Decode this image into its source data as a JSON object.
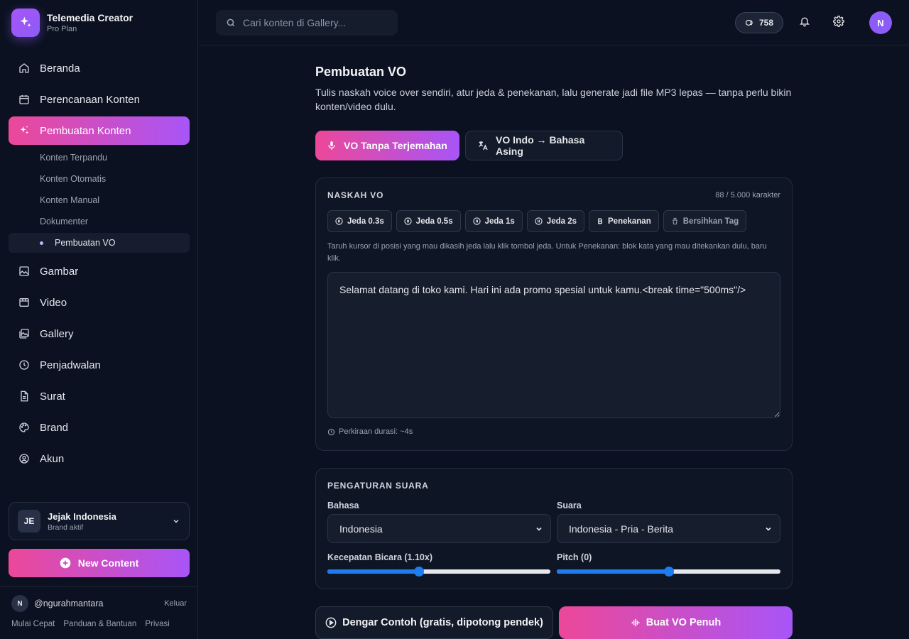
{
  "app": {
    "name": "Telemedia Creator",
    "plan": "Pro Plan"
  },
  "sidebar": {
    "items": [
      {
        "label": "Beranda",
        "icon": "home-icon"
      },
      {
        "label": "Perencanaan Konten",
        "icon": "calendar-icon"
      },
      {
        "label": "Pembuatan Konten",
        "icon": "sparkles-icon",
        "active": true
      },
      {
        "label": "Gambar",
        "icon": "image-icon"
      },
      {
        "label": "Video",
        "icon": "clapperboard-icon"
      },
      {
        "label": "Gallery",
        "icon": "images-icon"
      },
      {
        "label": "Penjadwalan",
        "icon": "clock-icon"
      },
      {
        "label": "Surat",
        "icon": "document-icon"
      },
      {
        "label": "Brand",
        "icon": "palette-icon"
      },
      {
        "label": "Akun",
        "icon": "user-circle-icon"
      }
    ],
    "subitems": [
      {
        "label": "Konten Terpandu"
      },
      {
        "label": "Konten Otomatis"
      },
      {
        "label": "Konten Manual"
      },
      {
        "label": "Dokumenter"
      },
      {
        "label": "Pembuatan VO",
        "active": true
      }
    ],
    "brand_switch": {
      "initials": "JE",
      "name": "Jejak Indonesia",
      "status": "Brand aktif"
    },
    "new_content_label": "New Content",
    "user": {
      "initial": "N",
      "handle": "@ngurahmantara",
      "logout": "Keluar"
    },
    "footer_links": [
      "Mulai Cepat",
      "Panduan & Bantuan",
      "Privasi"
    ]
  },
  "topbar": {
    "search_placeholder": "Cari konten di Gallery...",
    "credits": "758",
    "avatar_initial": "N"
  },
  "page": {
    "title": "Pembuatan VO",
    "description": "Tulis naskah voice over sendiri, atur jeda & penekanan, lalu generate jadi file MP3 lepas — tanpa perlu bikin konten/video dulu.",
    "tabs": [
      {
        "label": "VO Tanpa Terjemahan",
        "active": true
      },
      {
        "label": "VO Indo → Bahasa Asing",
        "active": false
      }
    ]
  },
  "script_card": {
    "title": "NASKAH VO",
    "char_count": "88 / 5.000 karakter",
    "tag_buttons": [
      "Jeda 0.3s",
      "Jeda 0.5s",
      "Jeda 1s",
      "Jeda 2s",
      "Penekanan",
      "Bersihkan Tag"
    ],
    "hint": "Taruh kursor di posisi yang mau dikasih jeda lalu klik tombol jeda. Untuk Penekanan: blok kata yang mau ditekankan dulu, baru klik.",
    "text_value": "Selamat datang di toko kami. Hari ini ada promo spesial untuk kamu.<break time=\"500ms\"/>",
    "duration": "Perkiraan durasi: ~4s"
  },
  "voice_card": {
    "title": "PENGATURAN SUARA",
    "language_label": "Bahasa",
    "language_value": "Indonesia",
    "voice_label": "Suara",
    "voice_value": "Indonesia - Pria - Berita",
    "speed_label": "Kecepatan Bicara (1.10x)",
    "speed_level": 0.41,
    "pitch_label": "Pitch (0)",
    "pitch_level": 0.5
  },
  "actions": {
    "preview_label": "Dengar Contoh (gratis, dipotong pendek)",
    "generate_label": "Buat VO Penuh"
  },
  "colors": {
    "accent_gradient_start": "#ec4899",
    "accent_gradient_end": "#a855f7",
    "slider_blue": "#1d7cf2",
    "background": "#0b1120"
  }
}
